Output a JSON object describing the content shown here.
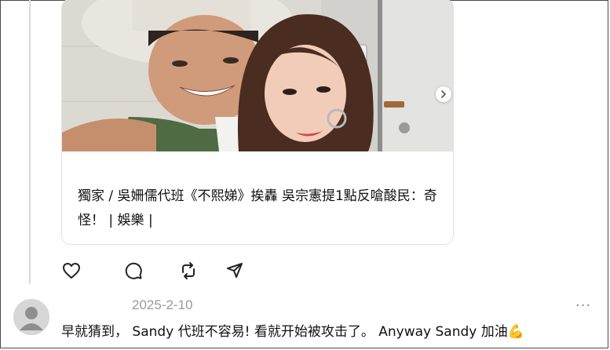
{
  "post": {
    "card": {
      "title": "獨家 / 吳姍儒代班《不熙娣》挨轟 吳宗憲提1點反嗆酸民：奇怪！ | 娛樂 |"
    },
    "carousel": {
      "next_icon": "chevron-right-icon"
    },
    "actions": [
      {
        "icon": "heart-icon"
      },
      {
        "icon": "comment-icon"
      },
      {
        "icon": "repost-icon"
      },
      {
        "icon": "share-icon"
      }
    ]
  },
  "reply": {
    "avatar_icon": "user-icon",
    "date": "2025-2-10",
    "more_icon": "more-icon",
    "more_label": "···",
    "text": "早就猜到， Sandy 代班不容易! 看就开始被攻击了。 Anyway Sandy 加油",
    "emoji": "💪"
  },
  "colors": {
    "border": "#4a4a4a",
    "muted": "#9a9a9a",
    "icon": "#222222"
  }
}
